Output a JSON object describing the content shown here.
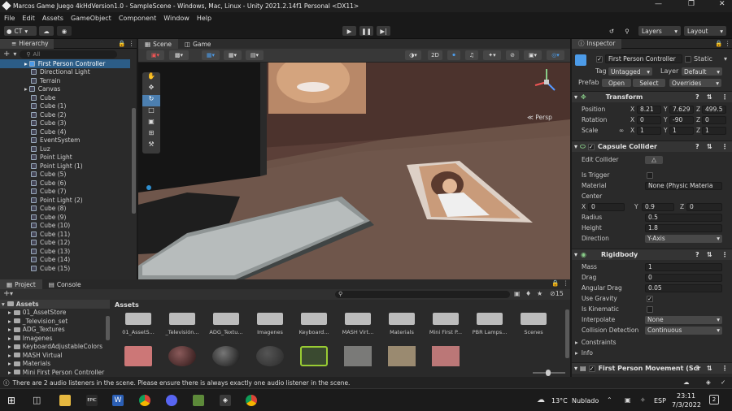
{
  "window": {
    "title": "Marcos Game Juego 4kHdVersion1.0 - SampleScene - Windows, Mac, Linux - Unity 2021.2.14f1 Personal <DX11>"
  },
  "menu": [
    "File",
    "Edit",
    "Assets",
    "GameObject",
    "Component",
    "Window",
    "Help"
  ],
  "toolbar": {
    "account": "CT",
    "layers": "Layers",
    "layout": "Layout"
  },
  "hierarchy": {
    "tab": "Hierarchy",
    "search_placeholder": "All",
    "items": [
      "First Person Controller",
      "Directional Light",
      "Terrain",
      "Canvas",
      "Cube",
      "Cube (1)",
      "Cube (2)",
      "Cube (3)",
      "Cube (4)",
      "EventSystem",
      "Luz",
      "Point Light",
      "Point Light (1)",
      "Cube (5)",
      "Cube (6)",
      "Cube (7)",
      "Point Light (2)",
      "Cube (8)",
      "Cube (9)",
      "Cube (10)",
      "Cube (11)",
      "Cube (12)",
      "Cube (13)",
      "Cube (14)",
      "Cube (15)"
    ]
  },
  "scene": {
    "tab_scene": "Scene",
    "tab_game": "Game",
    "mode_2d": "2D",
    "persp": "Persp"
  },
  "inspector": {
    "tab": "Inspector",
    "object_name": "First Person Controller",
    "static": "Static",
    "tag_label": "Tag",
    "tag_value": "Untagged",
    "layer_label": "Layer",
    "layer_value": "Default",
    "prefab_label": "Prefab",
    "open": "Open",
    "select": "Select",
    "overrides": "Overrides",
    "transform": {
      "title": "Transform",
      "position": {
        "label": "Position",
        "x": "8.21",
        "y": "7.629",
        "z": "499.5"
      },
      "rotation": {
        "label": "Rotation",
        "x": "0",
        "y": "-90",
        "z": "0"
      },
      "scale": {
        "label": "Scale",
        "x": "1",
        "y": "1",
        "z": "1"
      }
    },
    "capsule": {
      "title": "Capsule Collider",
      "edit_collider": "Edit Collider",
      "is_trigger": "Is Trigger",
      "material": "Material",
      "material_value": "None (Physic Materia",
      "center": "Center",
      "cx": "0",
      "cy": "0.9",
      "cz": "0",
      "radius_label": "Radius",
      "radius": "0.5",
      "height_label": "Height",
      "height": "1.8",
      "direction_label": "Direction",
      "direction": "Y-Axis"
    },
    "rigidbody": {
      "title": "Rigidbody",
      "mass_label": "Mass",
      "mass": "1",
      "drag_label": "Drag",
      "drag": "0",
      "angular_label": "Angular Drag",
      "angular": "0.05",
      "gravity_label": "Use Gravity",
      "kinematic_label": "Is Kinematic",
      "interpolate_label": "Interpolate",
      "interpolate": "None",
      "collision_label": "Collision Detection",
      "collision": "Continuous"
    },
    "constraints": "Constraints",
    "info": "Info",
    "fpm": "First Person Movement (Scr"
  },
  "project": {
    "tab_project": "Project",
    "tab_console": "Console",
    "assets_header": "Assets",
    "hidden_count": "15",
    "tree": [
      "Assets",
      "01_AssetStore",
      "_Television_set",
      "ADG_Textures",
      "Imagenes",
      "KeyboardAdjustableColors",
      "MASH Virtual",
      "Materials",
      "Mini First Person Controller"
    ],
    "folders": [
      "01_AssetS...",
      "_Televisión...",
      "ADG_Textu...",
      "Imagenes",
      "Keyboard...",
      "MASH Virt...",
      "Materials",
      "Mini First P...",
      "PBR Lamps...",
      "Scenes"
    ]
  },
  "status": {
    "message": "There are 2 audio listeners in the scene. Please ensure there is always exactly one audio listener in the scene."
  },
  "taskbar": {
    "temp": "13°C",
    "weather": "Nublado",
    "lang": "ESP",
    "time": "23:11",
    "date": "7/3/2022",
    "notif": "2"
  },
  "colors": {
    "selection": "#2c5d87",
    "panel": "#2a2a2a",
    "accent_blue": "#4c9be8"
  }
}
